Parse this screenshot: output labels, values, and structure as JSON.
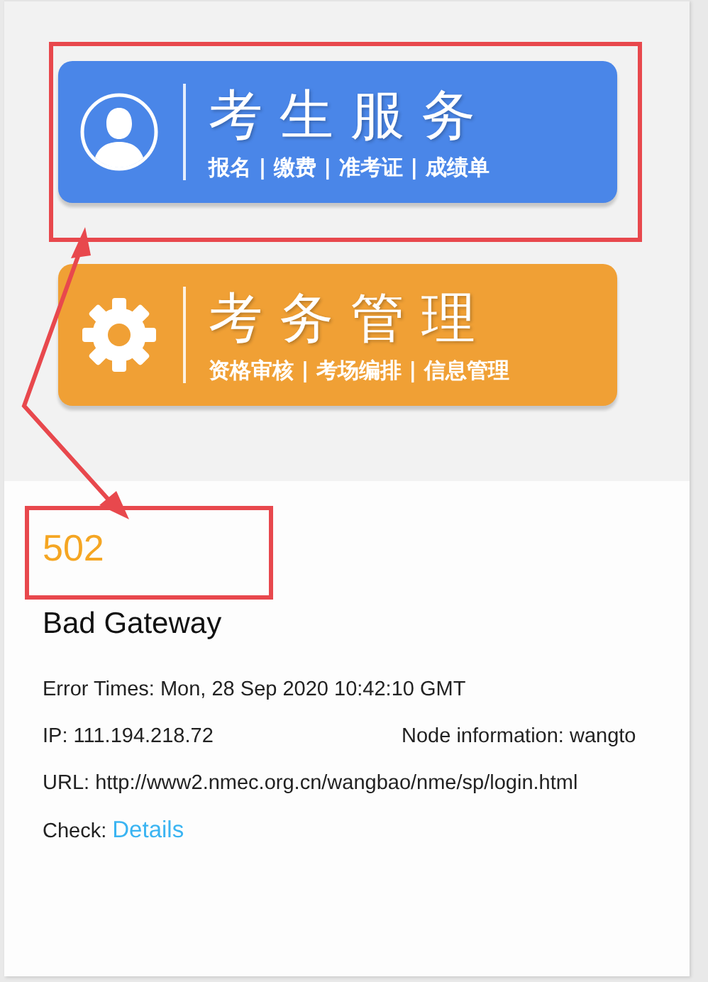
{
  "tiles": [
    {
      "kind": "service",
      "title": "考生服务",
      "subtitle": "报名 | 缴费 | 准考证 | 成绩单",
      "color": "#4a86e8"
    },
    {
      "kind": "admin",
      "title": "考务管理",
      "subtitle": "资格审核 | 考场编排 | 信息管理",
      "color": "#f0a035"
    }
  ],
  "error": {
    "code": "502",
    "message": "Bad Gateway",
    "error_times": "Error Times: Mon, 28 Sep 2020 10:42:10 GMT",
    "ip": "IP: 111.194.218.72",
    "node": "Node information: wangto",
    "url": "URL: http://www2.nmec.org.cn/wangbao/nme/sp/login.html",
    "check_label": "Check:",
    "check_link": "Details"
  }
}
